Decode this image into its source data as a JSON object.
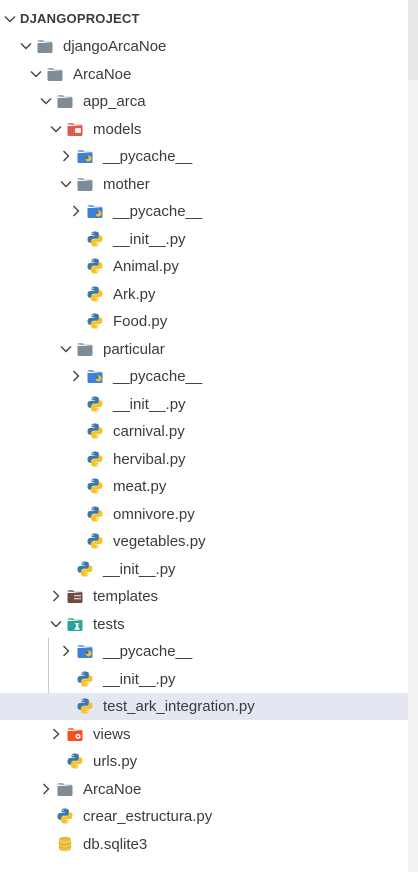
{
  "explorer": {
    "title": "DJANGOPROJECT",
    "items": [
      {
        "label": "djangoArcaNoe",
        "kind": "folder",
        "expanded": true
      },
      {
        "label": "ArcaNoe",
        "kind": "folder",
        "expanded": true
      },
      {
        "label": "app_arca",
        "kind": "folder",
        "expanded": true
      },
      {
        "label": "models",
        "kind": "folder-models",
        "expanded": true
      },
      {
        "label": "__pycache__",
        "kind": "folder-pycache",
        "expanded": false
      },
      {
        "label": "mother",
        "kind": "folder",
        "expanded": true
      },
      {
        "label": "__pycache__",
        "kind": "folder-pycache",
        "expanded": false
      },
      {
        "label": "__init__.py",
        "kind": "python"
      },
      {
        "label": "Animal.py",
        "kind": "python"
      },
      {
        "label": "Ark.py",
        "kind": "python"
      },
      {
        "label": "Food.py",
        "kind": "python"
      },
      {
        "label": "particular",
        "kind": "folder",
        "expanded": true
      },
      {
        "label": "__pycache__",
        "kind": "folder-pycache",
        "expanded": false
      },
      {
        "label": "__init__.py",
        "kind": "python"
      },
      {
        "label": "carnival.py",
        "kind": "python"
      },
      {
        "label": "hervibal.py",
        "kind": "python"
      },
      {
        "label": "meat.py",
        "kind": "python"
      },
      {
        "label": "omnivore.py",
        "kind": "python"
      },
      {
        "label": "vegetables.py",
        "kind": "python"
      },
      {
        "label": "__init__.py",
        "kind": "python"
      },
      {
        "label": "templates",
        "kind": "folder-templates",
        "expanded": false
      },
      {
        "label": "tests",
        "kind": "folder-tests",
        "expanded": true
      },
      {
        "label": "__pycache__",
        "kind": "folder-pycache",
        "expanded": false
      },
      {
        "label": "__init__.py",
        "kind": "python"
      },
      {
        "label": "test_ark_integration.py",
        "kind": "python",
        "selected": true
      },
      {
        "label": "views",
        "kind": "folder-views",
        "expanded": false
      },
      {
        "label": "urls.py",
        "kind": "python"
      },
      {
        "label": "ArcaNoe",
        "kind": "folder",
        "expanded": false
      },
      {
        "label": "crear_estructura.py",
        "kind": "python"
      },
      {
        "label": "db.sqlite3",
        "kind": "database"
      }
    ]
  }
}
